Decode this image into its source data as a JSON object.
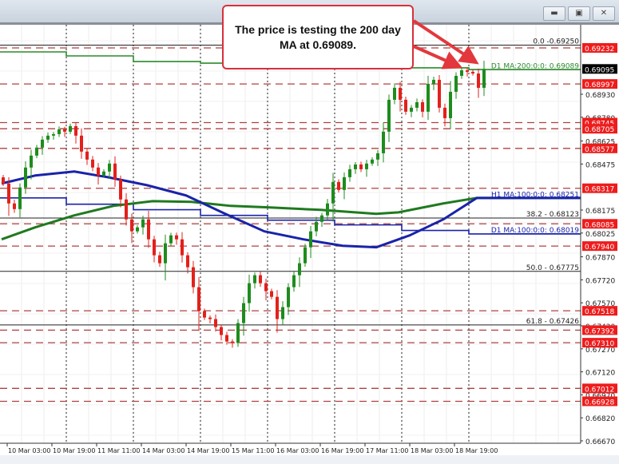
{
  "window": {
    "buttons": [
      {
        "name": "minimize",
        "glyph": "▬"
      },
      {
        "name": "restore",
        "glyph": "▣"
      },
      {
        "name": "close",
        "glyph": "✕"
      }
    ]
  },
  "annotation": {
    "text": "The price is testing the 200 day MA at 0.69089."
  },
  "chart_data": {
    "type": "candlestick",
    "ylim": [
      0.6667,
      0.693
    ],
    "grid": true,
    "colors": {
      "bull": "#1e8c1e",
      "bear": "#e3201b",
      "level": "#b04040",
      "level_label": "#ee1c1c",
      "h1_ma100": "#1a23a8",
      "h1_ma200": "#1f7a1f",
      "d1_ma100": "#1a23a8",
      "d1_ma200": "#2b8a2b",
      "fib": "#222222",
      "current": "#000000"
    },
    "x_tick_labels": [
      "10 Mar 03:00",
      "10 Mar 19:00",
      "11 Mar 11:00",
      "14 Mar 03:00",
      "14 Mar 19:00",
      "15 Mar 11:00",
      "16 Mar 03:00",
      "16 Mar 19:00",
      "17 Mar 11:00",
      "18 Mar 03:00",
      "18 Mar 19:00"
    ],
    "day_separators": [
      "11 Mar",
      "14 Mar",
      "15 Mar",
      "16 Mar",
      "17 Mar",
      "18 Mar",
      "19 Mar"
    ],
    "y_tick_labels": [
      "0.68930",
      "0.68780",
      "0.68625",
      "0.68475",
      "0.68175",
      "0.68025",
      "0.67870",
      "0.67720",
      "0.67570",
      "0.67420",
      "0.67270",
      "0.67120",
      "0.66970",
      "0.66820",
      "0.66670"
    ],
    "closes": [
      0.68348,
      0.68218,
      0.68181,
      0.68322,
      0.68452,
      0.6853,
      0.68582,
      0.68634,
      0.6866,
      0.6867,
      0.68701,
      0.68686,
      0.68722,
      0.6866,
      0.68556,
      0.68504,
      0.68452,
      0.684,
      0.68426,
      0.68478,
      0.68374,
      0.68244,
      0.68114,
      0.68036,
      0.68062,
      0.68114,
      0.67984,
      0.6788,
      0.67828,
      0.67958,
      0.6801,
      0.67984,
      0.6788,
      0.67802,
      0.67672,
      0.67516,
      0.67474,
      0.67464,
      0.67412,
      0.6736,
      0.67318,
      0.67308,
      0.67438,
      0.67568,
      0.67698,
      0.6775,
      0.67698,
      0.67646,
      0.67609,
      0.67464,
      0.67542,
      0.67672,
      0.6775,
      0.67828,
      0.67932,
      0.68036,
      0.68098,
      0.6814,
      0.68218,
      0.68358,
      0.68306,
      0.68389,
      0.68441,
      0.68472,
      0.68441,
      0.68478,
      0.68504,
      0.68545,
      0.68686,
      0.68894,
      0.68972,
      0.68894,
      0.68816,
      0.68842,
      0.68878,
      0.68816,
      0.68998,
      0.69024,
      0.68842,
      0.68774,
      0.68946,
      0.6905,
      0.69086,
      0.69076,
      0.69065,
      0.68972,
      0.69095
    ],
    "current_price": "0.69095",
    "levels": [
      "0.69232",
      "0.68997",
      "0.68745",
      "0.68705",
      "0.68577",
      "0.68317",
      "0.68085",
      "0.67940",
      "0.67518",
      "0.67392",
      "0.67310",
      "0.67012",
      "0.66928"
    ],
    "fib_levels": [
      {
        "price": 0.6925,
        "label": "0.0 -0.69250"
      },
      {
        "price": 0.68123,
        "label": "38.2 - 0.68123"
      },
      {
        "price": 0.67775,
        "label": "50.0 - 0.67775"
      },
      {
        "price": 0.67426,
        "label": "61.8 - 0.67426"
      }
    ],
    "h1_ma100": {
      "label": "H1 MA:100:0:0: 0.68251",
      "points": [
        [
          0,
          0.68348
        ],
        [
          6,
          0.684
        ],
        [
          13,
          0.68426
        ],
        [
          19,
          0.68389
        ],
        [
          26,
          0.68337
        ],
        [
          33,
          0.6827
        ],
        [
          40,
          0.6815
        ],
        [
          47,
          0.68036
        ],
        [
          54,
          0.67984
        ],
        [
          61,
          0.67942
        ],
        [
          67,
          0.67932
        ],
        [
          73,
          0.6801
        ],
        [
          79,
          0.68114
        ],
        [
          85,
          0.68254
        ]
      ]
    },
    "h1_ma200": {
      "points": [
        [
          0,
          0.67984
        ],
        [
          6,
          0.68062
        ],
        [
          13,
          0.6814
        ],
        [
          20,
          0.68202
        ],
        [
          27,
          0.68233
        ],
        [
          34,
          0.68228
        ],
        [
          41,
          0.68202
        ],
        [
          48,
          0.68192
        ],
        [
          57,
          0.68176
        ],
        [
          67,
          0.6815
        ],
        [
          71,
          0.6816
        ],
        [
          79,
          0.68218
        ],
        [
          85,
          0.68254
        ]
      ]
    },
    "d1_ma100": {
      "label": "D1 MA:100:0:0: 0.68019",
      "daily": [
        0.68254,
        0.68213,
        0.68177,
        0.6814,
        0.68109,
        0.68078,
        0.68042,
        0.68019
      ]
    },
    "d1_ma200": {
      "label": "D1 MA:200:0:0: 0.69089",
      "daily": [
        0.69206,
        0.6918,
        0.69143,
        0.69133,
        0.69123,
        0.69112,
        0.69102,
        0.69091
      ]
    }
  }
}
